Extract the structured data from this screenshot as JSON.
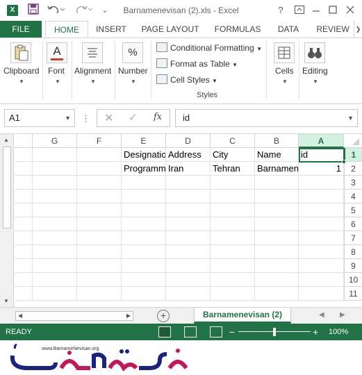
{
  "title_bar": {
    "app_icon": "X",
    "doc_title": "Barnamenevisan (2).xls - Excel",
    "help_label": "?",
    "icons": [
      "excel-app-icon",
      "save-icon",
      "undo-icon",
      "redo-icon",
      "customize-qat-icon",
      "help-icon",
      "ribbon-display-icon",
      "minimize-icon",
      "maximize-icon",
      "close-icon"
    ]
  },
  "tabs": {
    "file": "FILE",
    "items": [
      "HOME",
      "INSERT",
      "PAGE LAYOUT",
      "FORMULAS",
      "DATA",
      "REVIEW"
    ],
    "active": "HOME"
  },
  "ribbon": {
    "groups": {
      "clipboard": "Clipboard",
      "font": "Font",
      "alignment": "Alignment",
      "number": "Number",
      "cells": "Cells",
      "editing": "Editing"
    },
    "number_symbol": "%",
    "font_symbol": "A",
    "styles": {
      "conditional_formatting": "Conditional Formatting",
      "format_as_table": "Format as Table",
      "cell_styles": "Cell Styles",
      "group_label": "Styles"
    }
  },
  "formula_bar": {
    "name_box": "A1",
    "fx": "fx",
    "value": "id"
  },
  "grid": {
    "columns": [
      "G",
      "F",
      "E",
      "D",
      "C",
      "B",
      "A"
    ],
    "selected_column": "A",
    "rows": [
      "1",
      "2",
      "3",
      "4",
      "5",
      "6",
      "7",
      "8",
      "9",
      "10",
      "11"
    ],
    "selected_row": "1",
    "cells": {
      "E1": "Designation",
      "D1": "Address",
      "C1": "City",
      "B1": "Name",
      "A1": "id",
      "E2": "Programmer",
      "D2": "Iran",
      "C2": "Tehran",
      "B2": "Barnamenevisan",
      "A2": "1"
    }
  },
  "sheet_tabs": {
    "active": "Barnamenevisan (2)"
  },
  "status_bar": {
    "ready": "READY",
    "zoom_minus": "−",
    "zoom_plus": "+",
    "zoom": "100%",
    "zoom_level_percent": 100
  },
  "banner": {
    "logo_text": "برنامه نویسان",
    "logo_url_text": "www.BarnameNevisan.org"
  }
}
